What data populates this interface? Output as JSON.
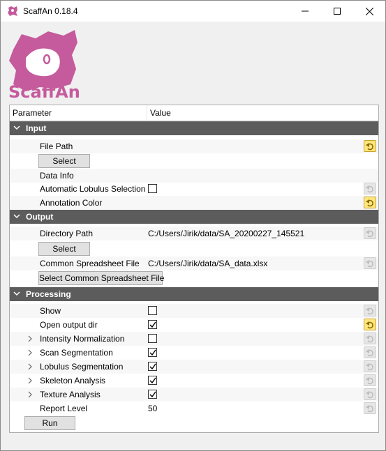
{
  "window": {
    "title": "ScaffAn 0.18.4"
  },
  "logo": {
    "text": "ScaffAn",
    "color": "#c55a9c"
  },
  "tree": {
    "columns": {
      "parameter": "Parameter",
      "value": "Value"
    },
    "groups": {
      "input": {
        "label": "Input",
        "file_path": {
          "label": "File Path",
          "value": ""
        },
        "select_button": "Select",
        "data_info": {
          "label": "Data Info"
        },
        "automatic_lobulus_selection": {
          "label": "Automatic Lobulus Selection",
          "checked": false
        },
        "annotation_color": {
          "label": "Annotation Color"
        }
      },
      "output": {
        "label": "Output",
        "directory_path": {
          "label": "Directory Path",
          "value": "C:/Users/Jirik/data/SA_20200227_145521"
        },
        "select_button": "Select",
        "common_spreadsheet_file": {
          "label": "Common Spreadsheet File",
          "value": "C:/Users/Jirik/data/SA_data.xlsx"
        },
        "select_common_button": "Select Common Spreadsheet File"
      },
      "processing": {
        "label": "Processing",
        "show": {
          "label": "Show",
          "checked": false
        },
        "open_output_dir": {
          "label": "Open output dir",
          "checked": true
        },
        "intensity_normalization": {
          "label": "Intensity Normalization",
          "checked": false
        },
        "scan_segmentation": {
          "label": "Scan Segmentation",
          "checked": true
        },
        "lobulus_segmentation": {
          "label": "Lobulus Segmentation",
          "checked": true
        },
        "skeleton_analysis": {
          "label": "Skeleton Analysis",
          "checked": true
        },
        "texture_analysis": {
          "label": "Texture Analysis",
          "checked": true
        },
        "report_level": {
          "label": "Report Level",
          "value": "50"
        },
        "run_button": "Run"
      }
    }
  },
  "colors": {
    "group_header_bg": "#5c5c5c",
    "reset_active": "#ffe680",
    "reset_inactive": "#e6e6e6",
    "brand": "#c55a9c"
  }
}
